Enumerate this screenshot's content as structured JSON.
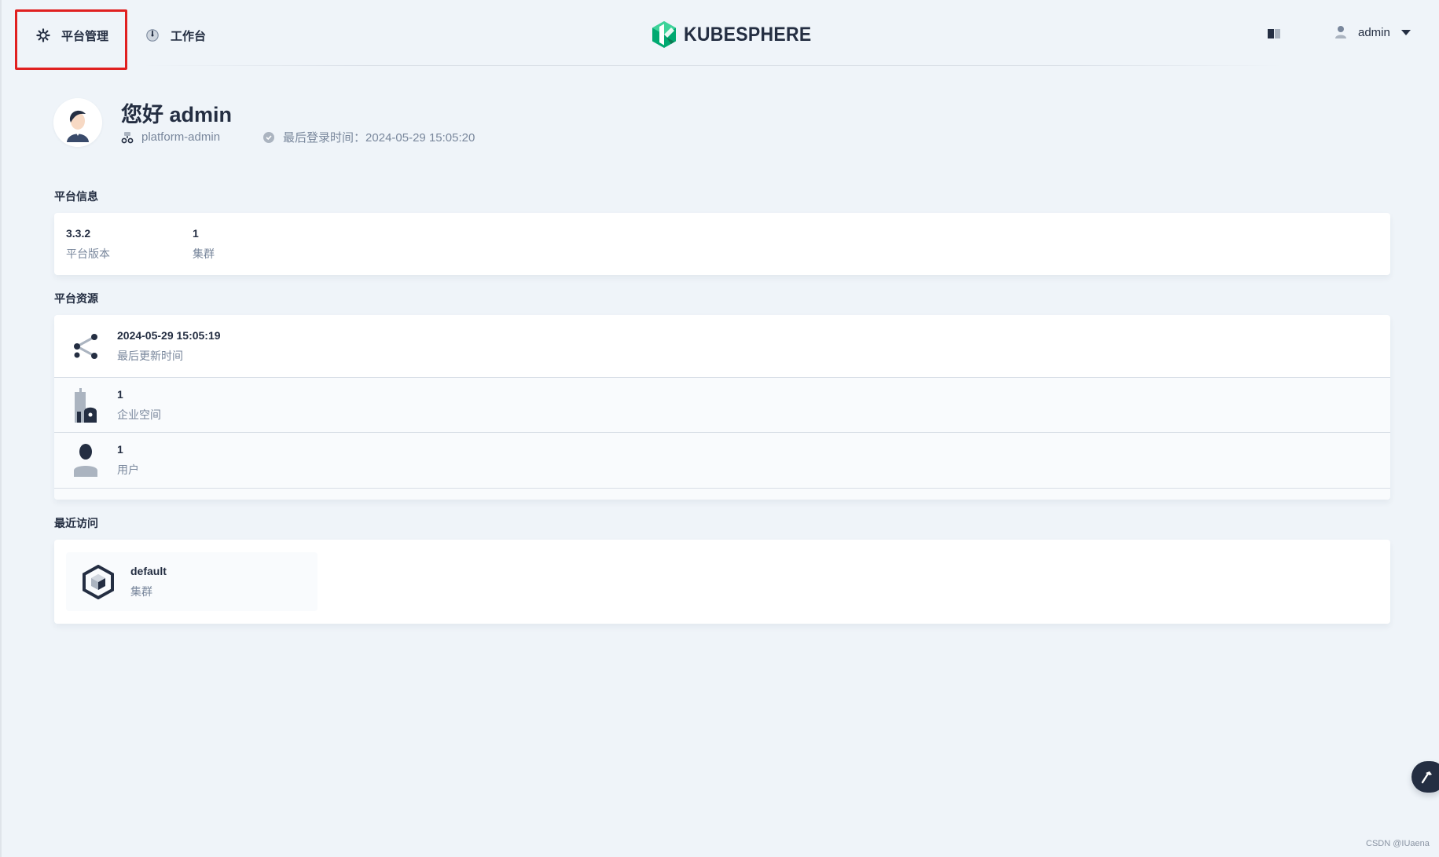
{
  "header": {
    "nav_platform_label": "平台管理",
    "nav_workbench_label": "工作台",
    "logo_text": "KUBESPHERE",
    "user_name": "admin"
  },
  "greeting": {
    "title": "您好 admin",
    "role": "platform-admin",
    "last_login": "最后登录时间：2024-05-29 15:05:20"
  },
  "platform_info": {
    "title": "平台信息",
    "items": [
      {
        "value": "3.3.2",
        "label": "平台版本"
      },
      {
        "value": "1",
        "label": "集群"
      }
    ]
  },
  "platform_resources": {
    "title": "平台资源",
    "rows": [
      {
        "value": "2024-05-29 15:05:19",
        "label": "最后更新时间",
        "icon": "share-nodes-icon"
      },
      {
        "value": "1",
        "label": "企业空间",
        "icon": "enterprise-building-icon"
      },
      {
        "value": "1",
        "label": "用户",
        "icon": "user-icon"
      }
    ]
  },
  "recent": {
    "title": "最近访问",
    "items": [
      {
        "name": "default",
        "type": "集群",
        "icon": "cluster-icon"
      }
    ]
  },
  "watermark": "CSDN @IUaena",
  "colors": {
    "background": "#eff4f9",
    "text_primary": "#242e42",
    "text_secondary": "#79879c",
    "brand_green": "#00a971",
    "highlight_red": "#e02020"
  }
}
